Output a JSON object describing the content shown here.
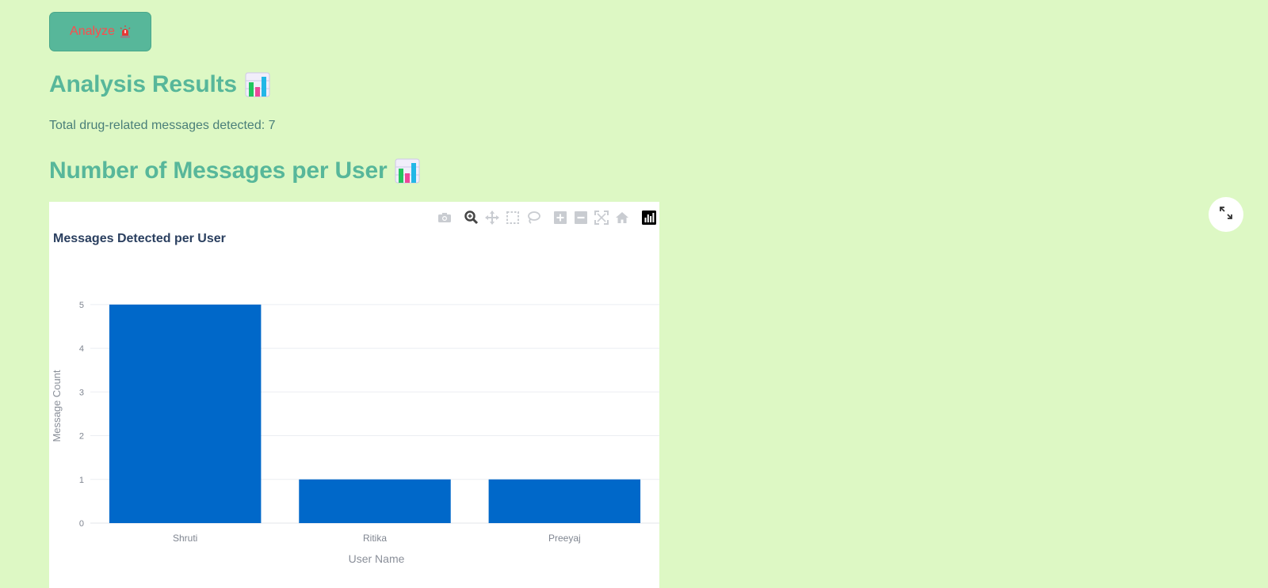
{
  "analyze_button": {
    "label": "Analyze",
    "icon": "siren-icon"
  },
  "results": {
    "title": "Analysis Results",
    "title_icon": "bar-chart-icon",
    "total_text": "Total drug-related messages detected: 7"
  },
  "per_user": {
    "title": "Number of Messages per User",
    "title_icon": "bar-chart-icon"
  },
  "modebar": {
    "buttons": [
      "camera-icon",
      "zoom-icon",
      "pan-icon",
      "box-select-icon",
      "lasso-select-icon",
      "zoom-in-icon",
      "zoom-out-icon",
      "autoscale-icon",
      "reset-axes-icon",
      "plotly-logo-icon"
    ]
  },
  "colors": {
    "background": "#ddf8c4",
    "accent": "#57b79a",
    "button_text": "#ff4b4b",
    "bar": "#0068c9"
  },
  "chart_data": {
    "type": "bar",
    "title": "Messages Detected per User",
    "categories": [
      "Shruti",
      "Ritika",
      "Preeyaj"
    ],
    "values": [
      5,
      1,
      1
    ],
    "xlabel": "User Name",
    "ylabel": "Message Count",
    "yticks": [
      "0",
      "1",
      "2",
      "3",
      "4",
      "5"
    ],
    "ylim": [
      0,
      5.45
    ],
    "grid": true
  }
}
